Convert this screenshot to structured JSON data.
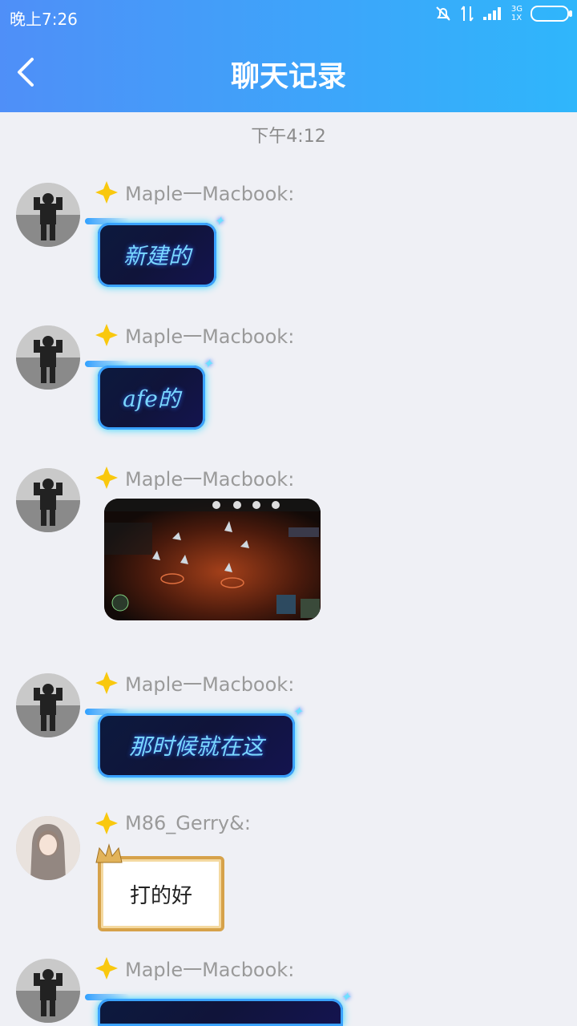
{
  "status_bar": {
    "time": "晚上7:26",
    "network": "3G",
    "speed": "1X"
  },
  "header": {
    "title": "聊天记录"
  },
  "divider_time": "下午4:12",
  "messages": [
    {
      "sender": "Maple一Macbook:",
      "type": "text",
      "text": "新建的"
    },
    {
      "sender": "Maple一Macbook:",
      "type": "text",
      "text": "afe的"
    },
    {
      "sender": "Maple一Macbook:",
      "type": "image",
      "image_desc": "space-game-screenshot"
    },
    {
      "sender": "Maple一Macbook:",
      "type": "text",
      "text": "那时候就在这"
    },
    {
      "sender": "M86_Gerry&:",
      "type": "text",
      "text": "打的好",
      "style": "gold"
    },
    {
      "sender": "Maple一Macbook:",
      "type": "text",
      "text": "",
      "style": "tech"
    }
  ],
  "colors": {
    "header_start": "#4f8ff8",
    "header_end": "#2fb6fb",
    "bg": "#eff0f5",
    "bubble_glow": "#2ad4ff",
    "name_color": "#9a9a9a"
  }
}
